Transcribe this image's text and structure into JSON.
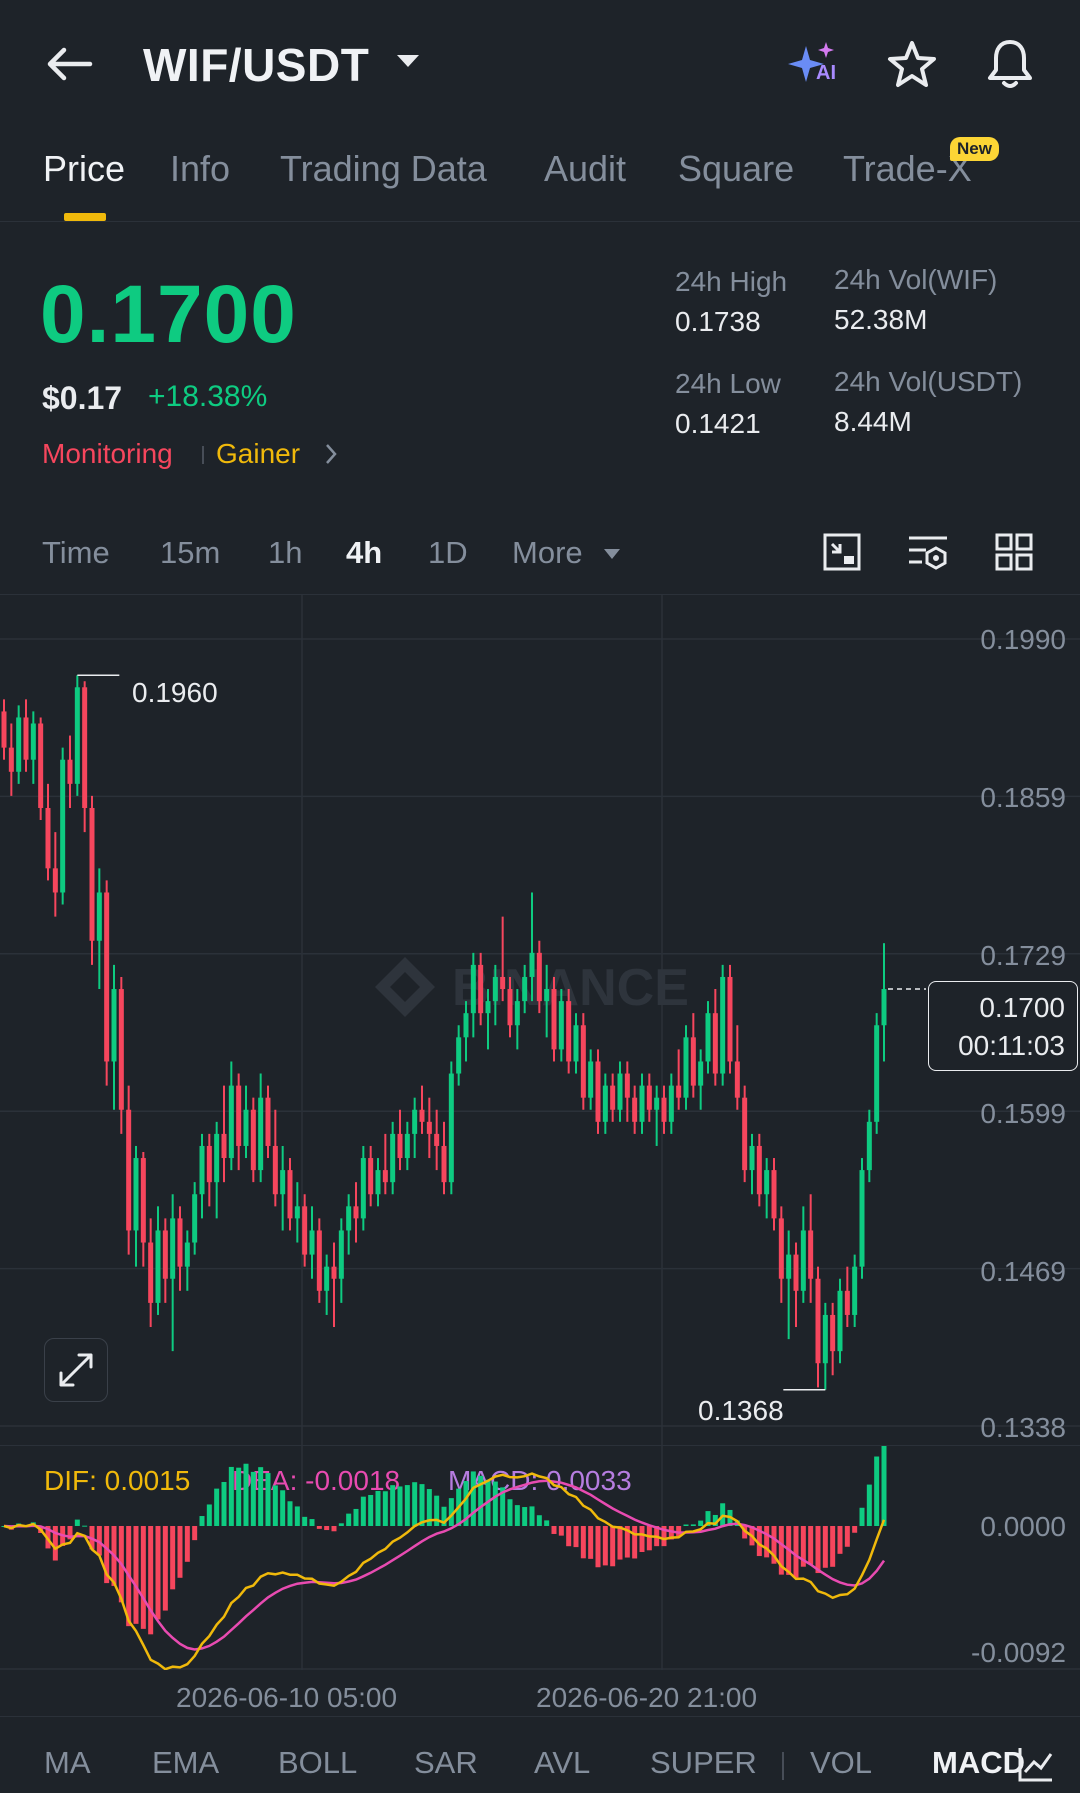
{
  "header": {
    "pair": "WIF/USDT",
    "ai_badge": "AI"
  },
  "tabs": [
    {
      "label": "Price",
      "active": true
    },
    {
      "label": "Info"
    },
    {
      "label": "Trading Data"
    },
    {
      "label": "Audit"
    },
    {
      "label": "Square"
    },
    {
      "label": "Trade-X",
      "badge": "New"
    }
  ],
  "ticker": {
    "last_price": "0.1700",
    "usd_price": "$0.17",
    "change": "+18.38%",
    "tag_monitoring": "Monitoring",
    "tag_gainer": "Gainer",
    "high_label": "24h High",
    "high_value": "0.1738",
    "low_label": "24h Low",
    "low_value": "0.1421",
    "vol_base_label": "24h Vol(WIF)",
    "vol_base_value": "52.38M",
    "vol_quote_label": "24h Vol(USDT)",
    "vol_quote_value": "8.44M"
  },
  "timeframes": {
    "items": [
      "Time",
      "15m",
      "1h",
      "4h",
      "1D"
    ],
    "active": "4h",
    "more_label": "More"
  },
  "chart": {
    "watermark": "BINANCE",
    "y_axis": [
      "0.1990",
      "0.1859",
      "0.1729",
      "0.1599",
      "0.1469",
      "0.1338"
    ],
    "high_marker": "0.1960",
    "low_marker": "0.1368",
    "current_price": "0.1700",
    "countdown": "00:11:03",
    "x_axis": [
      "2026-06-10 05:00",
      "2026-06-20 21:00"
    ]
  },
  "macd": {
    "dif_label": "DIF: 0.0015",
    "dea_label": "DEA: -0.0018",
    "macd_label": "MACD: 0.0033",
    "y_axis": [
      "0.0000",
      "-0.0092"
    ]
  },
  "indicators": {
    "items": [
      "MA",
      "EMA",
      "BOLL",
      "SAR",
      "AVL",
      "SUPER",
      "VOL",
      "MACD"
    ],
    "active": "MACD"
  },
  "colors": {
    "up": "#0ecb81",
    "down": "#f6465d",
    "accent": "#f0b90b",
    "dif": "#f0b90b",
    "dea": "#e84bb1",
    "macd": "#b67de0"
  },
  "chart_data": {
    "type": "candlestick",
    "interval": "4h",
    "ylim": [
      0.1338,
      0.199
    ],
    "candles_ohlc": [
      [
        0.193,
        0.194,
        0.189,
        0.19
      ],
      [
        0.19,
        0.192,
        0.186,
        0.188
      ],
      [
        0.188,
        0.1935,
        0.187,
        0.1925
      ],
      [
        0.1925,
        0.194,
        0.188,
        0.189
      ],
      [
        0.189,
        0.193,
        0.187,
        0.192
      ],
      [
        0.192,
        0.1925,
        0.184,
        0.185
      ],
      [
        0.185,
        0.187,
        0.179,
        0.18
      ],
      [
        0.18,
        0.183,
        0.176,
        0.178
      ],
      [
        0.178,
        0.19,
        0.177,
        0.189
      ],
      [
        0.189,
        0.191,
        0.185,
        0.187
      ],
      [
        0.187,
        0.196,
        0.186,
        0.195
      ],
      [
        0.195,
        0.1955,
        0.183,
        0.185
      ],
      [
        0.185,
        0.186,
        0.172,
        0.174
      ],
      [
        0.174,
        0.18,
        0.17,
        0.178
      ],
      [
        0.178,
        0.179,
        0.162,
        0.164
      ],
      [
        0.164,
        0.172,
        0.16,
        0.17
      ],
      [
        0.17,
        0.171,
        0.158,
        0.16
      ],
      [
        0.16,
        0.162,
        0.148,
        0.15
      ],
      [
        0.15,
        0.157,
        0.147,
        0.156
      ],
      [
        0.156,
        0.1565,
        0.147,
        0.149
      ],
      [
        0.149,
        0.151,
        0.142,
        0.144
      ],
      [
        0.144,
        0.152,
        0.143,
        0.15
      ],
      [
        0.15,
        0.151,
        0.144,
        0.146
      ],
      [
        0.146,
        0.153,
        0.14,
        0.151
      ],
      [
        0.151,
        0.152,
        0.145,
        0.147
      ],
      [
        0.147,
        0.15,
        0.145,
        0.149
      ],
      [
        0.149,
        0.154,
        0.148,
        0.153
      ],
      [
        0.153,
        0.158,
        0.151,
        0.157
      ],
      [
        0.157,
        0.158,
        0.152,
        0.154
      ],
      [
        0.154,
        0.159,
        0.151,
        0.158
      ],
      [
        0.158,
        0.162,
        0.154,
        0.156
      ],
      [
        0.156,
        0.164,
        0.155,
        0.162
      ],
      [
        0.162,
        0.163,
        0.155,
        0.157
      ],
      [
        0.157,
        0.162,
        0.156,
        0.16
      ],
      [
        0.16,
        0.161,
        0.154,
        0.155
      ],
      [
        0.155,
        0.163,
        0.154,
        0.161
      ],
      [
        0.161,
        0.162,
        0.156,
        0.157
      ],
      [
        0.157,
        0.16,
        0.152,
        0.153
      ],
      [
        0.153,
        0.157,
        0.15,
        0.155
      ],
      [
        0.155,
        0.156,
        0.15,
        0.151
      ],
      [
        0.151,
        0.154,
        0.149,
        0.152
      ],
      [
        0.152,
        0.153,
        0.147,
        0.148
      ],
      [
        0.148,
        0.152,
        0.146,
        0.15
      ],
      [
        0.15,
        0.151,
        0.144,
        0.145
      ],
      [
        0.145,
        0.148,
        0.143,
        0.147
      ],
      [
        0.147,
        0.149,
        0.142,
        0.146
      ],
      [
        0.146,
        0.151,
        0.144,
        0.15
      ],
      [
        0.15,
        0.153,
        0.148,
        0.152
      ],
      [
        0.152,
        0.154,
        0.149,
        0.151
      ],
      [
        0.151,
        0.157,
        0.15,
        0.156
      ],
      [
        0.156,
        0.157,
        0.152,
        0.153
      ],
      [
        0.153,
        0.156,
        0.152,
        0.155
      ],
      [
        0.155,
        0.158,
        0.153,
        0.154
      ],
      [
        0.154,
        0.159,
        0.153,
        0.158
      ],
      [
        0.158,
        0.16,
        0.155,
        0.156
      ],
      [
        0.156,
        0.159,
        0.155,
        0.158
      ],
      [
        0.158,
        0.161,
        0.156,
        0.16
      ],
      [
        0.16,
        0.162,
        0.158,
        0.159
      ],
      [
        0.159,
        0.161,
        0.156,
        0.158
      ],
      [
        0.158,
        0.16,
        0.155,
        0.157
      ],
      [
        0.157,
        0.159,
        0.153,
        0.154
      ],
      [
        0.154,
        0.164,
        0.153,
        0.163
      ],
      [
        0.163,
        0.167,
        0.162,
        0.166
      ],
      [
        0.166,
        0.169,
        0.164,
        0.168
      ],
      [
        0.168,
        0.173,
        0.166,
        0.172
      ],
      [
        0.172,
        0.173,
        0.167,
        0.168
      ],
      [
        0.168,
        0.17,
        0.165,
        0.169
      ],
      [
        0.169,
        0.172,
        0.167,
        0.171
      ],
      [
        0.171,
        0.176,
        0.169,
        0.17
      ],
      [
        0.17,
        0.171,
        0.166,
        0.167
      ],
      [
        0.167,
        0.17,
        0.165,
        0.169
      ],
      [
        0.169,
        0.172,
        0.168,
        0.171
      ],
      [
        0.171,
        0.178,
        0.169,
        0.173
      ],
      [
        0.173,
        0.174,
        0.168,
        0.169
      ],
      [
        0.169,
        0.172,
        0.166,
        0.17
      ],
      [
        0.17,
        0.171,
        0.164,
        0.165
      ],
      [
        0.165,
        0.17,
        0.164,
        0.169
      ],
      [
        0.169,
        0.17,
        0.163,
        0.164
      ],
      [
        0.164,
        0.168,
        0.163,
        0.167
      ],
      [
        0.167,
        0.168,
        0.16,
        0.161
      ],
      [
        0.161,
        0.165,
        0.16,
        0.164
      ],
      [
        0.164,
        0.165,
        0.158,
        0.159
      ],
      [
        0.159,
        0.163,
        0.158,
        0.162
      ],
      [
        0.162,
        0.163,
        0.159,
        0.16
      ],
      [
        0.16,
        0.164,
        0.159,
        0.163
      ],
      [
        0.163,
        0.164,
        0.159,
        0.161
      ],
      [
        0.161,
        0.162,
        0.158,
        0.159
      ],
      [
        0.159,
        0.163,
        0.158,
        0.162
      ],
      [
        0.162,
        0.163,
        0.159,
        0.16
      ],
      [
        0.16,
        0.162,
        0.157,
        0.161
      ],
      [
        0.161,
        0.162,
        0.158,
        0.159
      ],
      [
        0.159,
        0.163,
        0.158,
        0.162
      ],
      [
        0.162,
        0.165,
        0.16,
        0.161
      ],
      [
        0.161,
        0.167,
        0.16,
        0.166
      ],
      [
        0.166,
        0.168,
        0.161,
        0.162
      ],
      [
        0.162,
        0.165,
        0.16,
        0.164
      ],
      [
        0.164,
        0.169,
        0.163,
        0.168
      ],
      [
        0.168,
        0.17,
        0.162,
        0.163
      ],
      [
        0.163,
        0.172,
        0.162,
        0.171
      ],
      [
        0.171,
        0.172,
        0.163,
        0.164
      ],
      [
        0.164,
        0.167,
        0.16,
        0.161
      ],
      [
        0.161,
        0.162,
        0.154,
        0.155
      ],
      [
        0.155,
        0.158,
        0.153,
        0.157
      ],
      [
        0.157,
        0.158,
        0.152,
        0.153
      ],
      [
        0.153,
        0.156,
        0.151,
        0.155
      ],
      [
        0.155,
        0.156,
        0.15,
        0.151
      ],
      [
        0.151,
        0.152,
        0.144,
        0.146
      ],
      [
        0.146,
        0.15,
        0.141,
        0.148
      ],
      [
        0.148,
        0.149,
        0.142,
        0.145
      ],
      [
        0.145,
        0.152,
        0.144,
        0.15
      ],
      [
        0.15,
        0.153,
        0.144,
        0.146
      ],
      [
        0.146,
        0.147,
        0.137,
        0.139
      ],
      [
        0.139,
        0.144,
        0.1368,
        0.143
      ],
      [
        0.143,
        0.144,
        0.138,
        0.14
      ],
      [
        0.14,
        0.146,
        0.139,
        0.145
      ],
      [
        0.145,
        0.147,
        0.142,
        0.143
      ],
      [
        0.143,
        0.148,
        0.142,
        0.147
      ],
      [
        0.147,
        0.156,
        0.146,
        0.155
      ],
      [
        0.155,
        0.16,
        0.154,
        0.159
      ],
      [
        0.159,
        0.168,
        0.158,
        0.167
      ],
      [
        0.167,
        0.1738,
        0.164,
        0.17
      ]
    ]
  }
}
